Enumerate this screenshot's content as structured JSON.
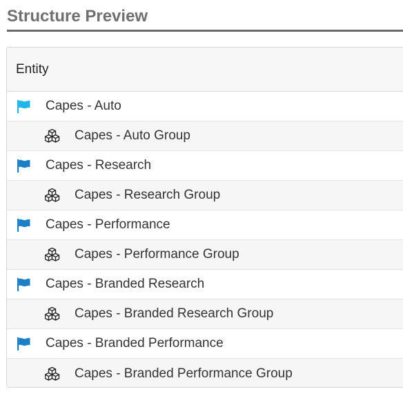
{
  "section": {
    "title": "Structure Preview"
  },
  "table": {
    "header": "Entity",
    "rows": [
      {
        "kind": "entity",
        "label": "Capes - Auto",
        "icon": "flag-icon",
        "icon_color": "#1fb6e8"
      },
      {
        "kind": "group",
        "label": "Capes - Auto Group",
        "icon": "cubes-icon"
      },
      {
        "kind": "entity",
        "label": "Capes - Research",
        "icon": "flag-icon",
        "icon_color": "#1a7fc4"
      },
      {
        "kind": "group",
        "label": "Capes - Research Group",
        "icon": "cubes-icon"
      },
      {
        "kind": "entity",
        "label": "Capes - Performance",
        "icon": "flag-icon",
        "icon_color": "#1a7fc4"
      },
      {
        "kind": "group",
        "label": "Capes - Performance Group",
        "icon": "cubes-icon"
      },
      {
        "kind": "entity",
        "label": "Capes - Branded Research",
        "icon": "flag-icon",
        "icon_color": "#1a7fc4"
      },
      {
        "kind": "group",
        "label": "Capes - Branded Research Group",
        "icon": "cubes-icon"
      },
      {
        "kind": "entity",
        "label": "Capes - Branded Performance",
        "icon": "flag-icon",
        "icon_color": "#1a7fc4"
      },
      {
        "kind": "group",
        "label": "Capes - Branded Performance Group",
        "icon": "cubes-icon"
      }
    ]
  }
}
